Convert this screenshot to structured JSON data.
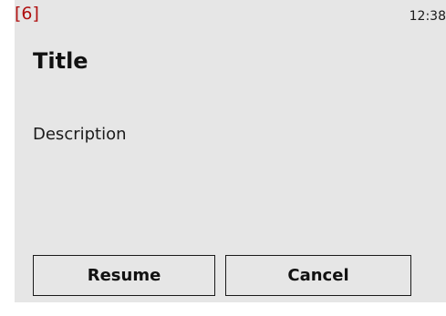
{
  "status_bar": {
    "badge": "[6]",
    "time": "12:38"
  },
  "dialog": {
    "title": "Title",
    "description": "Description",
    "buttons": {
      "resume": "Resume",
      "cancel": "Cancel"
    }
  },
  "colors": {
    "background": "#e6e6e6",
    "badge": "#b01010",
    "text": "#111111"
  }
}
